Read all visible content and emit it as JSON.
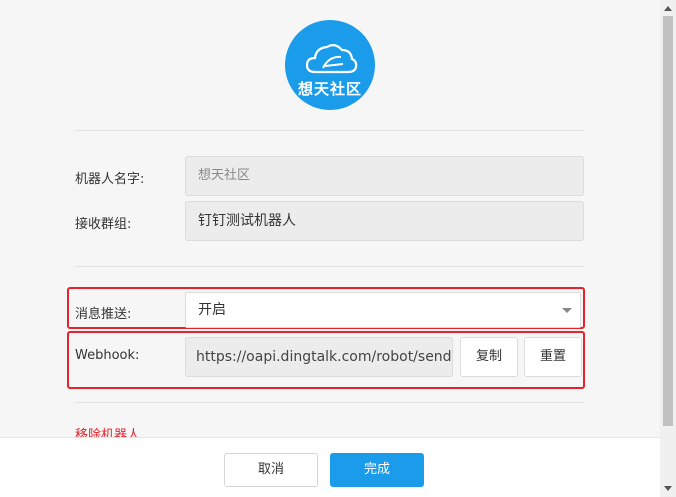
{
  "logo": {
    "text": "想天社区",
    "icon": "cloud-icon"
  },
  "form": {
    "name_label": "机器人名字:",
    "name_value": "想天社区",
    "group_label": "接收群组:",
    "group_value": "钉钉测试机器人",
    "push_label": "消息推送:",
    "push_value": "开启",
    "webhook_label": "Webhook:",
    "webhook_value": "https://oapi.dingtalk.com/robot/send",
    "copy_label": "复制",
    "reset_label": "重置",
    "remove_label": "移除机器人"
  },
  "footer": {
    "cancel_label": "取消",
    "done_label": "完成"
  },
  "colors": {
    "accent": "#1a9cea",
    "highlight": "#e5232d"
  }
}
